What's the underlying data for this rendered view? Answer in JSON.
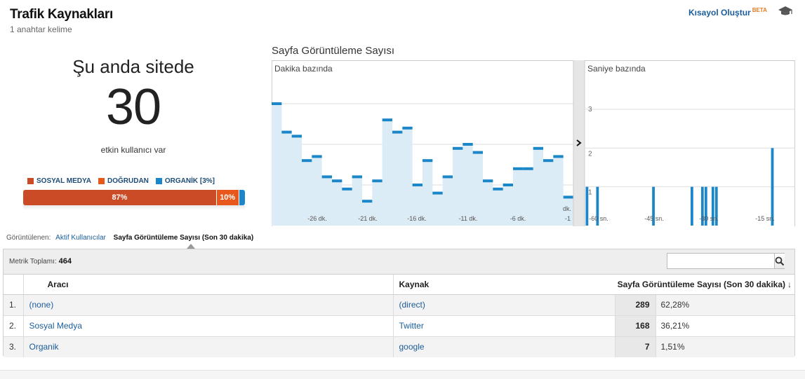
{
  "header": {
    "title": "Trafik Kaynakları",
    "subtitle": "1 anahtar kelime",
    "shortcut_label": "Kısayol Oluştur",
    "shortcut_badge": "BETA"
  },
  "online": {
    "heading": "Şu anda sitede",
    "count": "30",
    "label": "etkin kullanıcı var"
  },
  "legend": [
    {
      "label": "SOSYAL MEDYA",
      "color": "#cc4b27"
    },
    {
      "label": "DOĞRUDAN",
      "color": "#e8581c"
    },
    {
      "label": "ORGANİK [3%]",
      "color": "#1b87c9"
    }
  ],
  "share_bar": [
    {
      "label": "87%",
      "value": 87,
      "color": "#cc4b27"
    },
    {
      "label": "10%",
      "value": 10,
      "color": "#e8581c"
    },
    {
      "label": "",
      "value": 3,
      "color": "#1b87c9"
    }
  ],
  "chart": {
    "title": "Sayfa Görüntüleme Sayısı",
    "left_pane_label": "Dakika bazında",
    "right_pane_label": "Saniye bazında"
  },
  "chart_data": [
    {
      "type": "area",
      "title": "Dakika bazında",
      "x_tick_labels": [
        "-26 dk.",
        "-21 dk.",
        "-16 dk.",
        "-11 dk.",
        "-6 dk.",
        "-1 dk."
      ],
      "y_ticks": [
        10,
        20,
        30
      ],
      "ylim": [
        0,
        32
      ],
      "x": [
        -30,
        -29,
        -28,
        -27,
        -26,
        -25,
        -24,
        -23,
        -22,
        -21,
        -20,
        -19,
        -18,
        -17,
        -16,
        -15,
        -14,
        -13,
        -12,
        -11,
        -10,
        -9,
        -8,
        -7,
        -6,
        -5,
        -4,
        -3,
        -2,
        -1
      ],
      "values": [
        30,
        23,
        22,
        16,
        17,
        12,
        11,
        9,
        12,
        6,
        11,
        26,
        23,
        24,
        10,
        16,
        8,
        12,
        19,
        20,
        18,
        11,
        9,
        10,
        14,
        14,
        19,
        16,
        17,
        7
      ],
      "grid": true
    },
    {
      "type": "bar",
      "title": "Saniye bazında",
      "x_tick_labels": [
        "-60 sn.",
        "-45 sn.",
        "-30 sn.",
        "-15 sn."
      ],
      "y_ticks": [
        1,
        2,
        3
      ],
      "ylim": [
        0,
        3.1
      ],
      "x": [
        -60,
        -59,
        -58,
        -57,
        -56,
        -55,
        -54,
        -53,
        -52,
        -51,
        -50,
        -49,
        -48,
        -47,
        -46,
        -45,
        -44,
        -43,
        -42,
        -41,
        -40,
        -39,
        -38,
        -37,
        -36,
        -35,
        -34,
        -33,
        -32,
        -31,
        -30,
        -29,
        -28,
        -27,
        -26,
        -25,
        -24,
        -23,
        -22,
        -21,
        -20,
        -19,
        -18,
        -17,
        -16,
        -15,
        -14,
        -13,
        -12,
        -11,
        -10,
        -9,
        -8,
        -7,
        -6,
        -5,
        -4,
        -3,
        -2,
        -1
      ],
      "values": [
        1,
        0,
        0,
        1,
        0,
        0,
        0,
        0,
        0,
        0,
        0,
        0,
        0,
        0,
        0,
        0,
        0,
        0,
        0,
        1,
        0,
        0,
        0,
        0,
        0,
        0,
        0,
        0,
        0,
        0,
        1,
        0,
        0,
        1,
        1,
        0,
        1,
        1,
        0,
        0,
        0,
        0,
        0,
        0,
        0,
        0,
        0,
        0,
        0,
        0,
        0,
        0,
        0,
        2,
        0,
        0,
        0,
        0,
        0,
        0
      ],
      "grid": true
    }
  ],
  "view": {
    "prefix": "Görüntülenen:",
    "tab_active_users": "Aktif Kullanıcılar",
    "tab_pageviews": "Sayfa Görüntüleme Sayısı (Son 30 dakika)"
  },
  "table": {
    "metric_total_label": "Metrik Toplamı:",
    "metric_total_value": "464",
    "search_placeholder": "",
    "headers": {
      "medium": "Aracı",
      "source": "Kaynak",
      "metric": "Sayfa Görüntüleme Sayısı (Son 30 dakika)"
    },
    "rows": [
      {
        "index": "1.",
        "medium": "(none)",
        "source": "(direct)",
        "value": "289",
        "percent": "62,28%"
      },
      {
        "index": "2.",
        "medium": "Sosyal Medya",
        "source": "Twitter",
        "value": "168",
        "percent": "36,21%"
      },
      {
        "index": "3.",
        "medium": "Organik",
        "source": "google",
        "value": "7",
        "percent": "1,51%"
      }
    ]
  },
  "colors": {
    "accent": "#1b87c9",
    "area_fill": "#dcecf6",
    "link": "#1a5c9a"
  }
}
